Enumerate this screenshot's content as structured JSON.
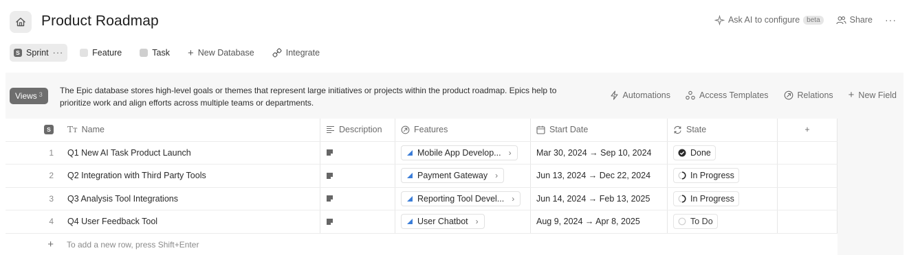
{
  "header": {
    "title": "Product Roadmap",
    "ask_ai": "Ask AI to configure",
    "beta": "beta",
    "share": "Share",
    "more": "···"
  },
  "tabs": [
    {
      "label": "Sprint",
      "badge": "S",
      "more": "···"
    },
    {
      "label": "Feature"
    },
    {
      "label": "Task"
    },
    {
      "label": "New Database"
    },
    {
      "label": "Integrate"
    }
  ],
  "panel": {
    "views_label": "Views",
    "views_count": "3",
    "description": "The Epic database stores high-level goals or themes that represent large initiatives or projects within the product roadmap. Epics help to prioritize work and align efforts across multiple teams or departments.",
    "toolbar": {
      "automations": "Automations",
      "access_templates": "Access Templates",
      "relations": "Relations",
      "new_field": "New Field"
    }
  },
  "table": {
    "badge": "S",
    "columns": {
      "name": "Name",
      "description": "Description",
      "features": "Features",
      "start_date": "Start Date",
      "state": "State",
      "add": "+"
    },
    "rows": [
      {
        "idx": "1",
        "name": "Q1 New AI Task Product Launch",
        "feature": "Mobile App Develop...",
        "dates": "Mar 30, 2024 → Sep 10, 2024",
        "state": "Done"
      },
      {
        "idx": "2",
        "name": "Q2 Integration with Third Party Tools",
        "feature": "Payment Gateway",
        "dates": "Jun 13, 2024 → Dec 22, 2024",
        "state": "In Progress"
      },
      {
        "idx": "3",
        "name": "Q3 Analysis Tool Integrations",
        "feature": "Reporting Tool Devel...",
        "dates": "Jun 14, 2024 → Feb 13, 2025",
        "state": "In Progress"
      },
      {
        "idx": "4",
        "name": "Q4 User Feedback Tool",
        "feature": "User Chatbot",
        "dates": "Aug 9, 2024 → Apr 8, 2025",
        "state": "To Do"
      }
    ],
    "add_row_hint": "To add a new row, press Shift+Enter",
    "add_row_plus": "+"
  },
  "colors": {
    "feature_icon": "#3b7dd8",
    "done_icon": "#2b2b2b",
    "views_bg": "#6e6e6e"
  }
}
